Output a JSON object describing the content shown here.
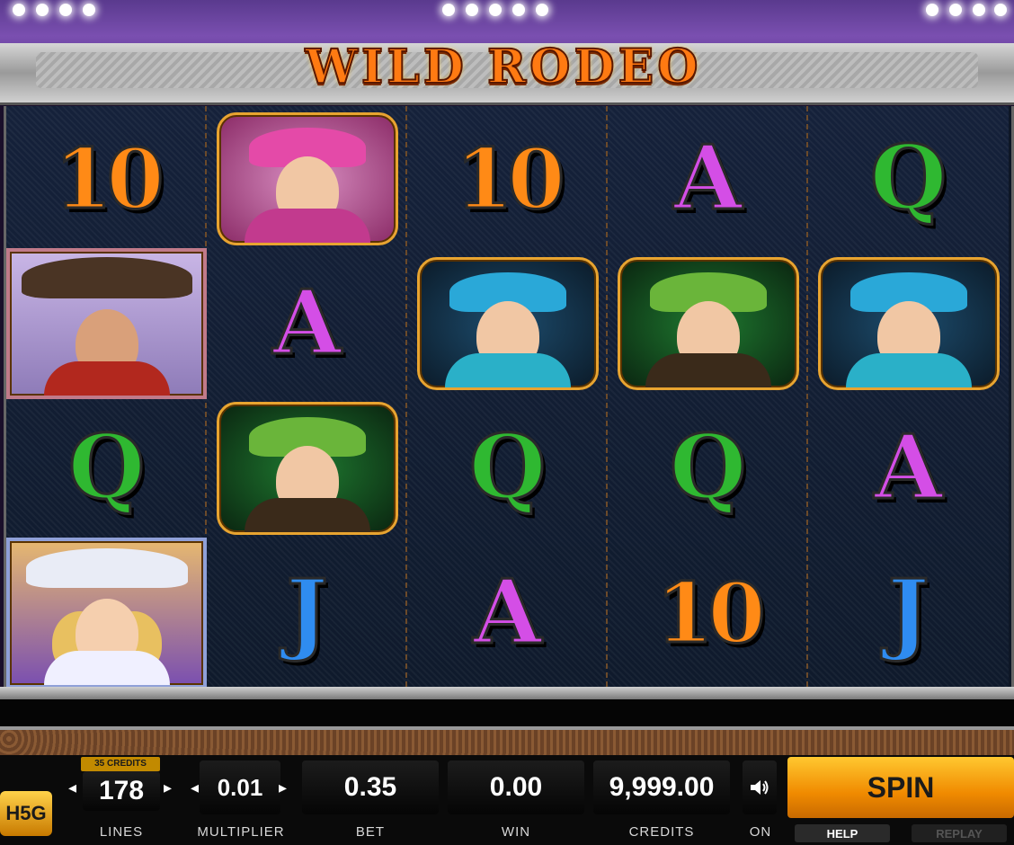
{
  "game": {
    "title": "WILD RODEO",
    "provider_logo": "H5G"
  },
  "reels": [
    [
      "10",
      "man-cowboy-portrait",
      "Q",
      "blonde-cowgirl-portrait"
    ],
    [
      "pink-cowgirl-portrait",
      "A",
      "green-cowgirl-portrait",
      "J"
    ],
    [
      "10",
      "blue-cowgirl-portrait",
      "Q",
      "A"
    ],
    [
      "A",
      "green-cowgirl-portrait",
      "Q",
      "10"
    ],
    [
      "Q",
      "blue-cowgirl-portrait",
      "A",
      "J"
    ]
  ],
  "controls": {
    "lines_badge": "35 CREDITS",
    "lines_value": "178",
    "lines_label": "LINES",
    "multiplier_value": "0.01",
    "multiplier_label": "MULTIPLIER",
    "bet_value": "0.35",
    "bet_label": "BET",
    "win_value": "0.00",
    "win_label": "WIN",
    "credits_value": "9,999.00",
    "credits_label": "CREDITS",
    "sound_label": "ON",
    "spin_label": "SPIN",
    "help_label": "HELP",
    "replay_label": "REPLAY",
    "arrow_left": "◂",
    "arrow_right": "▸",
    "sound_icon": "speaker-icon"
  },
  "colors": {
    "title": "#ff7a12",
    "spin_button": "#f08a00",
    "symbol_10": "#ff8a16",
    "symbol_A": "#d44ee6",
    "symbol_Q": "#2fb831",
    "symbol_J": "#2f8cf0"
  }
}
